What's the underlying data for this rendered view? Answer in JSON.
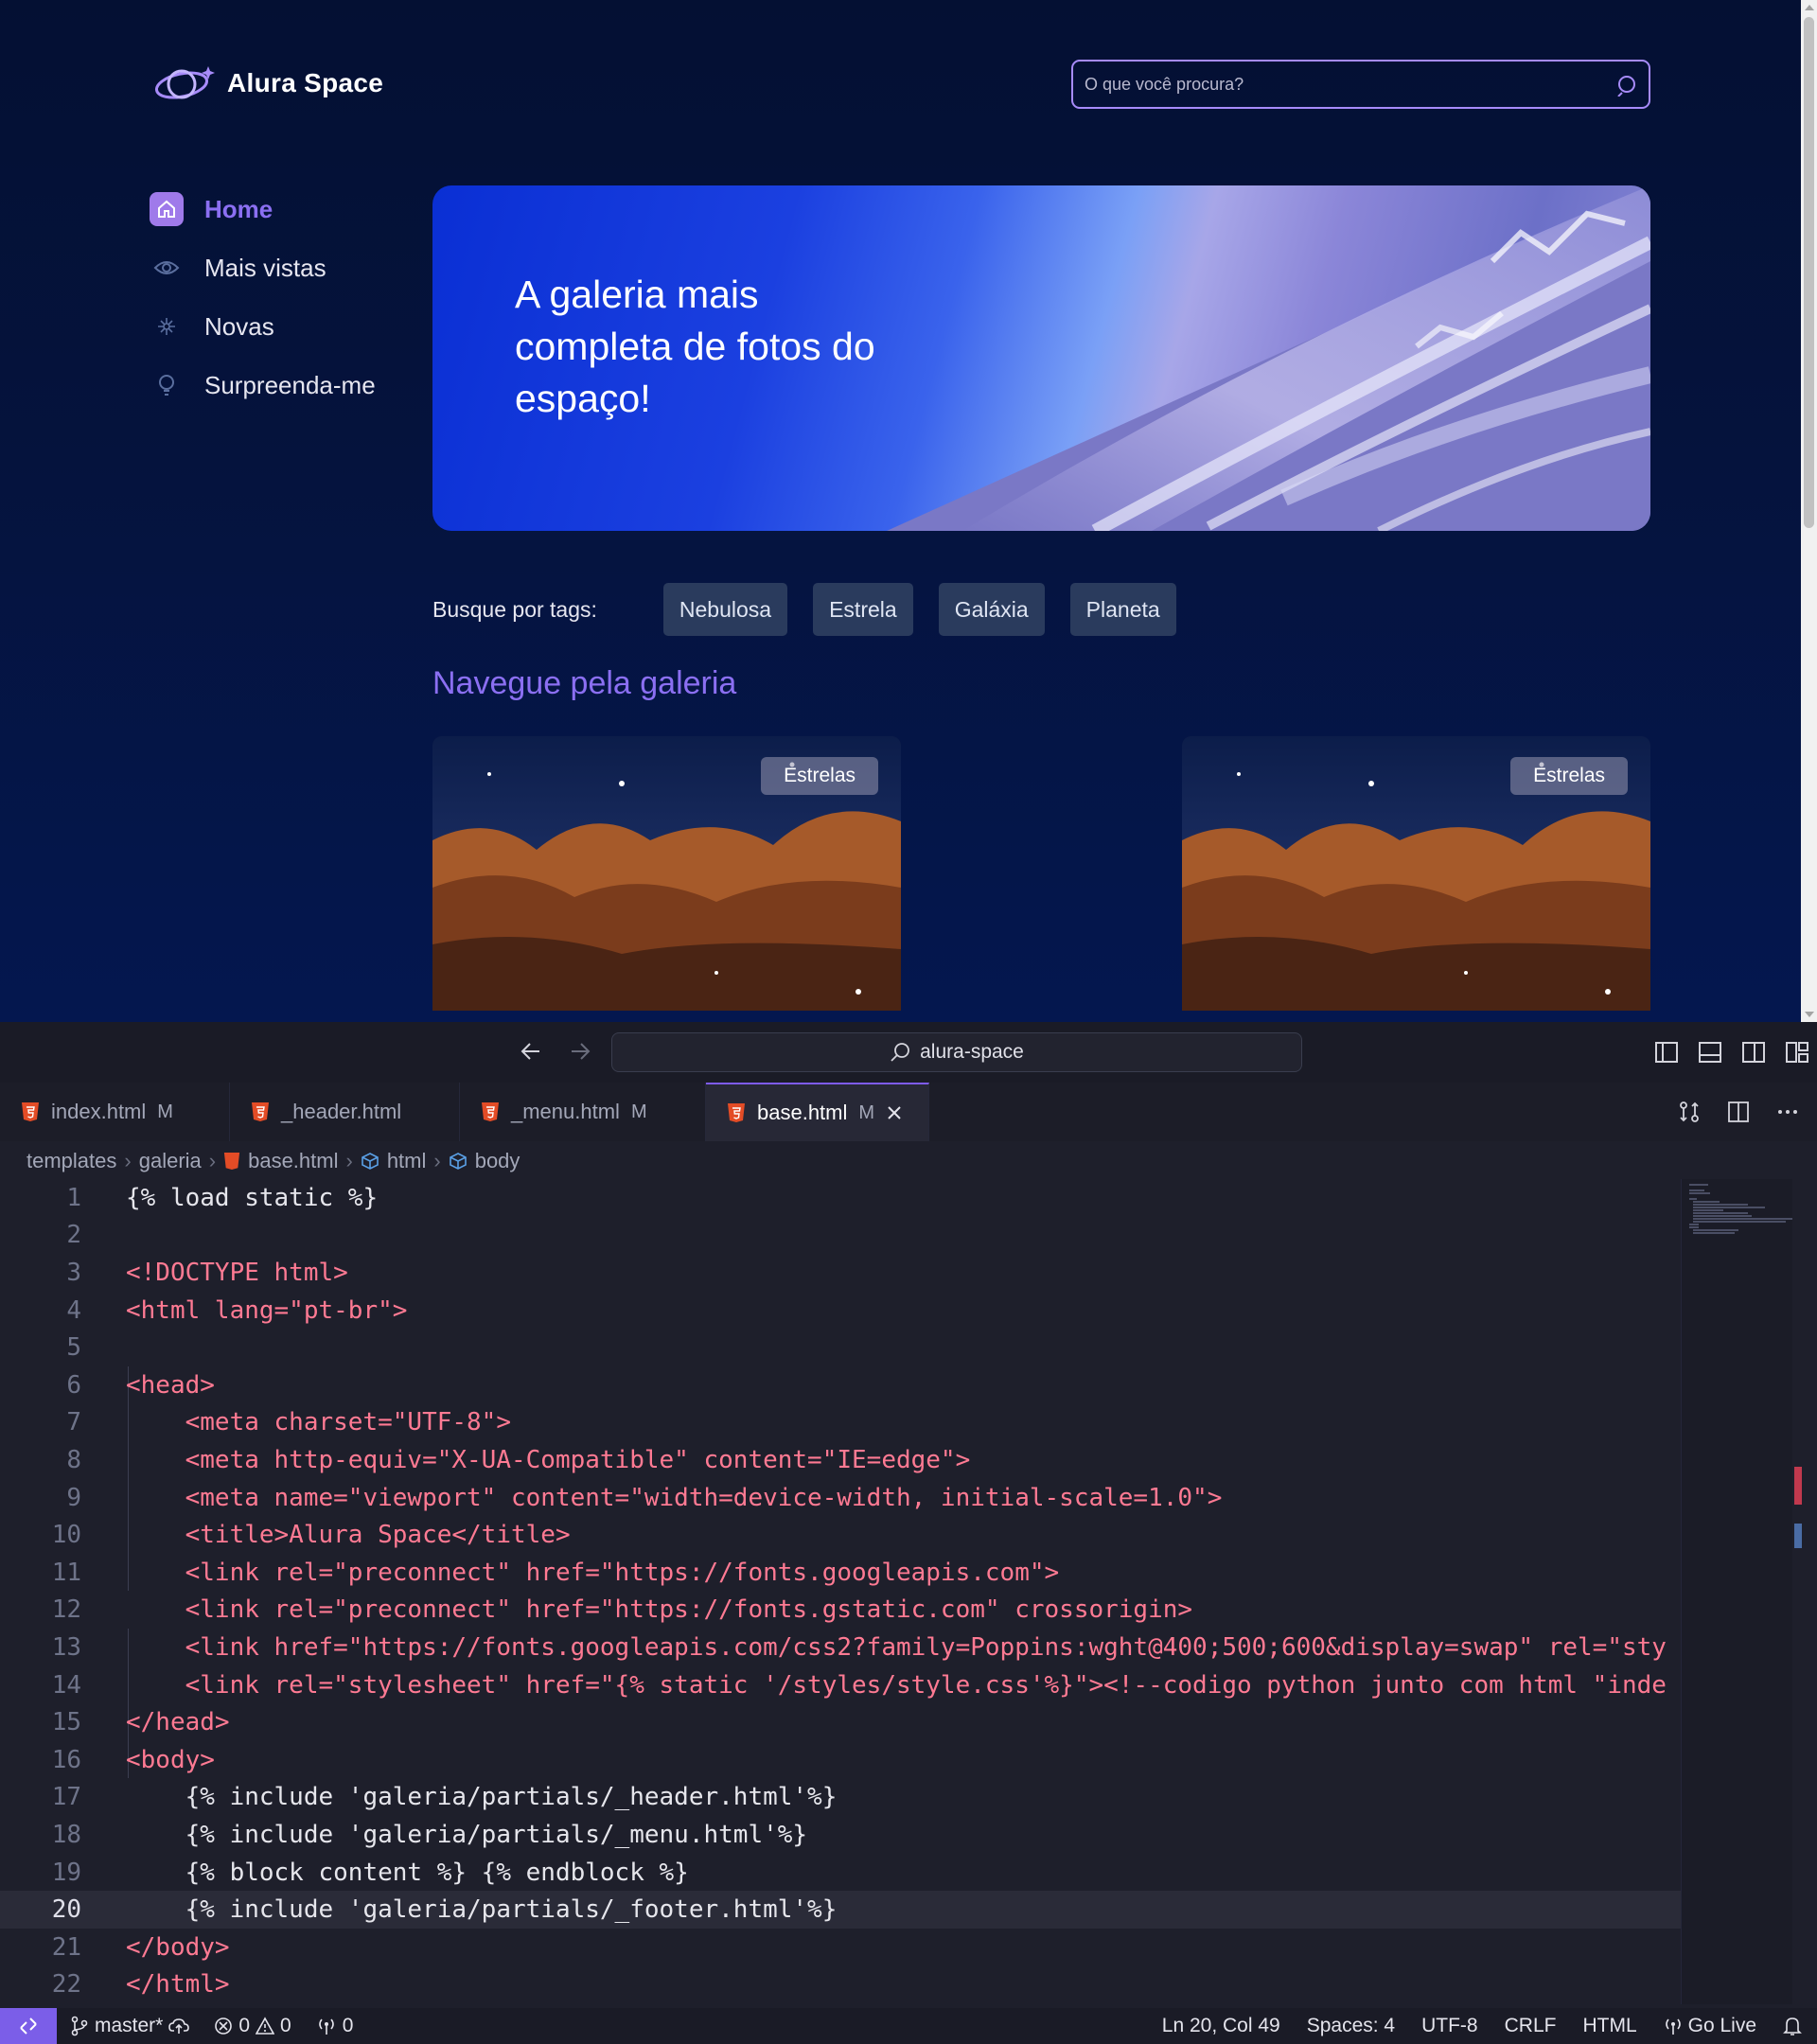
{
  "site": {
    "logo_text": "Alura Space",
    "search_placeholder": "O que você procura?",
    "nav": [
      {
        "label": "Home",
        "icon": "home-icon",
        "active": true
      },
      {
        "label": "Mais vistas",
        "icon": "eye-icon",
        "active": false
      },
      {
        "label": "Novas",
        "icon": "sparkle-icon",
        "active": false
      },
      {
        "label": "Surpreenda-me",
        "icon": "lightbulb-icon",
        "active": false
      }
    ],
    "banner_title": "A galeria mais completa de fotos do espaço!",
    "tags_label": "Busque por tags:",
    "tags": [
      "Nebulosa",
      "Estrela",
      "Galáxia",
      "Planeta"
    ],
    "gallery_title": "Navegue pela galeria",
    "cards": [
      {
        "tag": "Estrelas"
      },
      {
        "tag": "Estrelas"
      }
    ],
    "colors": {
      "accent": "#8b6ff2",
      "background": "#041033",
      "tag_bg": "#2a3b5d"
    }
  },
  "editor": {
    "command_center": "alura-space",
    "tabs": [
      {
        "name": "index.html",
        "badge": "M",
        "active": false
      },
      {
        "name": "_header.html",
        "badge": "",
        "active": false
      },
      {
        "name": "_menu.html",
        "badge": "M",
        "active": false
      },
      {
        "name": "base.html",
        "badge": "M",
        "active": true
      }
    ],
    "breadcrumb": [
      "templates",
      "galeria",
      "base.html",
      "html",
      "body"
    ],
    "lines": [
      {
        "n": "1",
        "text": "{% load static %}"
      },
      {
        "n": "2",
        "text": ""
      },
      {
        "n": "3",
        "text": "<!DOCTYPE html>"
      },
      {
        "n": "4",
        "text": "<html lang=\"pt-br\">"
      },
      {
        "n": "5",
        "text": ""
      },
      {
        "n": "6",
        "text": "<head>"
      },
      {
        "n": "7",
        "text": "    <meta charset=\"UTF-8\">"
      },
      {
        "n": "8",
        "text": "    <meta http-equiv=\"X-UA-Compatible\" content=\"IE=edge\">"
      },
      {
        "n": "9",
        "text": "    <meta name=\"viewport\" content=\"width=device-width, initial-scale=1.0\">"
      },
      {
        "n": "10",
        "text": "    <title>Alura Space</title>"
      },
      {
        "n": "11",
        "text": "    <link rel=\"preconnect\" href=\"https://fonts.googleapis.com\">"
      },
      {
        "n": "12",
        "text": "    <link rel=\"preconnect\" href=\"https://fonts.gstatic.com\" crossorigin>"
      },
      {
        "n": "13",
        "text": "    <link href=\"https://fonts.googleapis.com/css2?family=Poppins:wght@400;500;600&display=swap\" rel=\"sty"
      },
      {
        "n": "14",
        "text": "    <link rel=\"stylesheet\" href=\"{% static '/styles/style.css'%}\"><!--codigo python junto com html \"inde"
      },
      {
        "n": "15",
        "text": "</head>"
      },
      {
        "n": "16",
        "text": "<body>"
      },
      {
        "n": "17",
        "text": "    {% include 'galeria/partials/_header.html'%}"
      },
      {
        "n": "18",
        "text": "    {% include 'galeria/partials/_menu.html'%}"
      },
      {
        "n": "19",
        "text": "    {% block content %} {% endblock %}"
      },
      {
        "n": "20",
        "text": "    {% include 'galeria/partials/_footer.html'%}"
      },
      {
        "n": "21",
        "text": "</body>"
      },
      {
        "n": "22",
        "text": "</html>"
      }
    ],
    "current_line": "20",
    "status": {
      "branch": "master*",
      "errors": "0",
      "warnings": "0",
      "ports": "0",
      "position": "Ln 20, Col 49",
      "spaces": "Spaces: 4",
      "encoding": "UTF-8",
      "eol": "CRLF",
      "language": "HTML",
      "go_live": "Go Live"
    }
  }
}
